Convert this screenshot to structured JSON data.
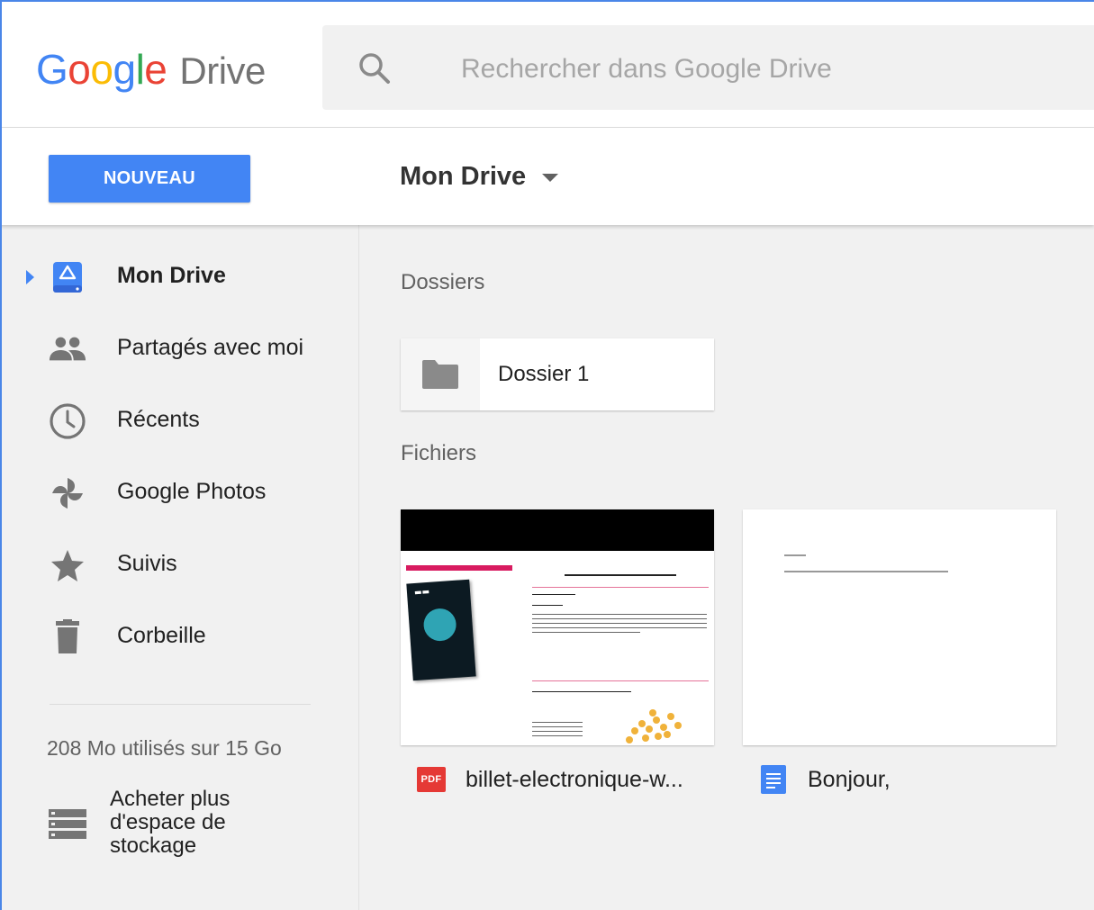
{
  "app": {
    "logo_letters": [
      "G",
      "o",
      "o",
      "g",
      "l",
      "e"
    ],
    "logo_drive": "Drive"
  },
  "search": {
    "placeholder": "Rechercher dans Google Drive",
    "icon": "search-icon"
  },
  "toolbar": {
    "new_label": "NOUVEAU",
    "breadcrumb": "Mon Drive"
  },
  "sidebar": {
    "items": [
      {
        "label": "Mon Drive",
        "icon": "drive-icon",
        "active": true
      },
      {
        "label": "Partagés avec moi",
        "icon": "people-icon"
      },
      {
        "label": "Récents",
        "icon": "clock-icon"
      },
      {
        "label": "Google Photos",
        "icon": "photos-pinwheel-icon"
      },
      {
        "label": "Suivis",
        "icon": "star-icon"
      },
      {
        "label": "Corbeille",
        "icon": "trash-icon"
      }
    ],
    "storage_text": "208 Mo utilisés sur 15 Go",
    "buy_storage": "Acheter plus d'espace de stockage"
  },
  "main": {
    "folders_title": "Dossiers",
    "folders": [
      {
        "name": "Dossier 1",
        "icon": "folder-icon"
      }
    ],
    "files_title": "Fichiers",
    "files": [
      {
        "name": "billet-electronique-w...",
        "type_label": "PDF",
        "icon": "pdf-file-icon"
      },
      {
        "name": "Bonjour,",
        "icon": "google-docs-icon"
      }
    ]
  },
  "colors": {
    "accent": "#4285f4",
    "sidebar_bg": "#f1f1f1",
    "pdf_red": "#e53935",
    "logo_blue": "#4285f4",
    "logo_red": "#ea4335",
    "logo_yellow": "#fbbc05",
    "logo_green": "#34a853"
  }
}
